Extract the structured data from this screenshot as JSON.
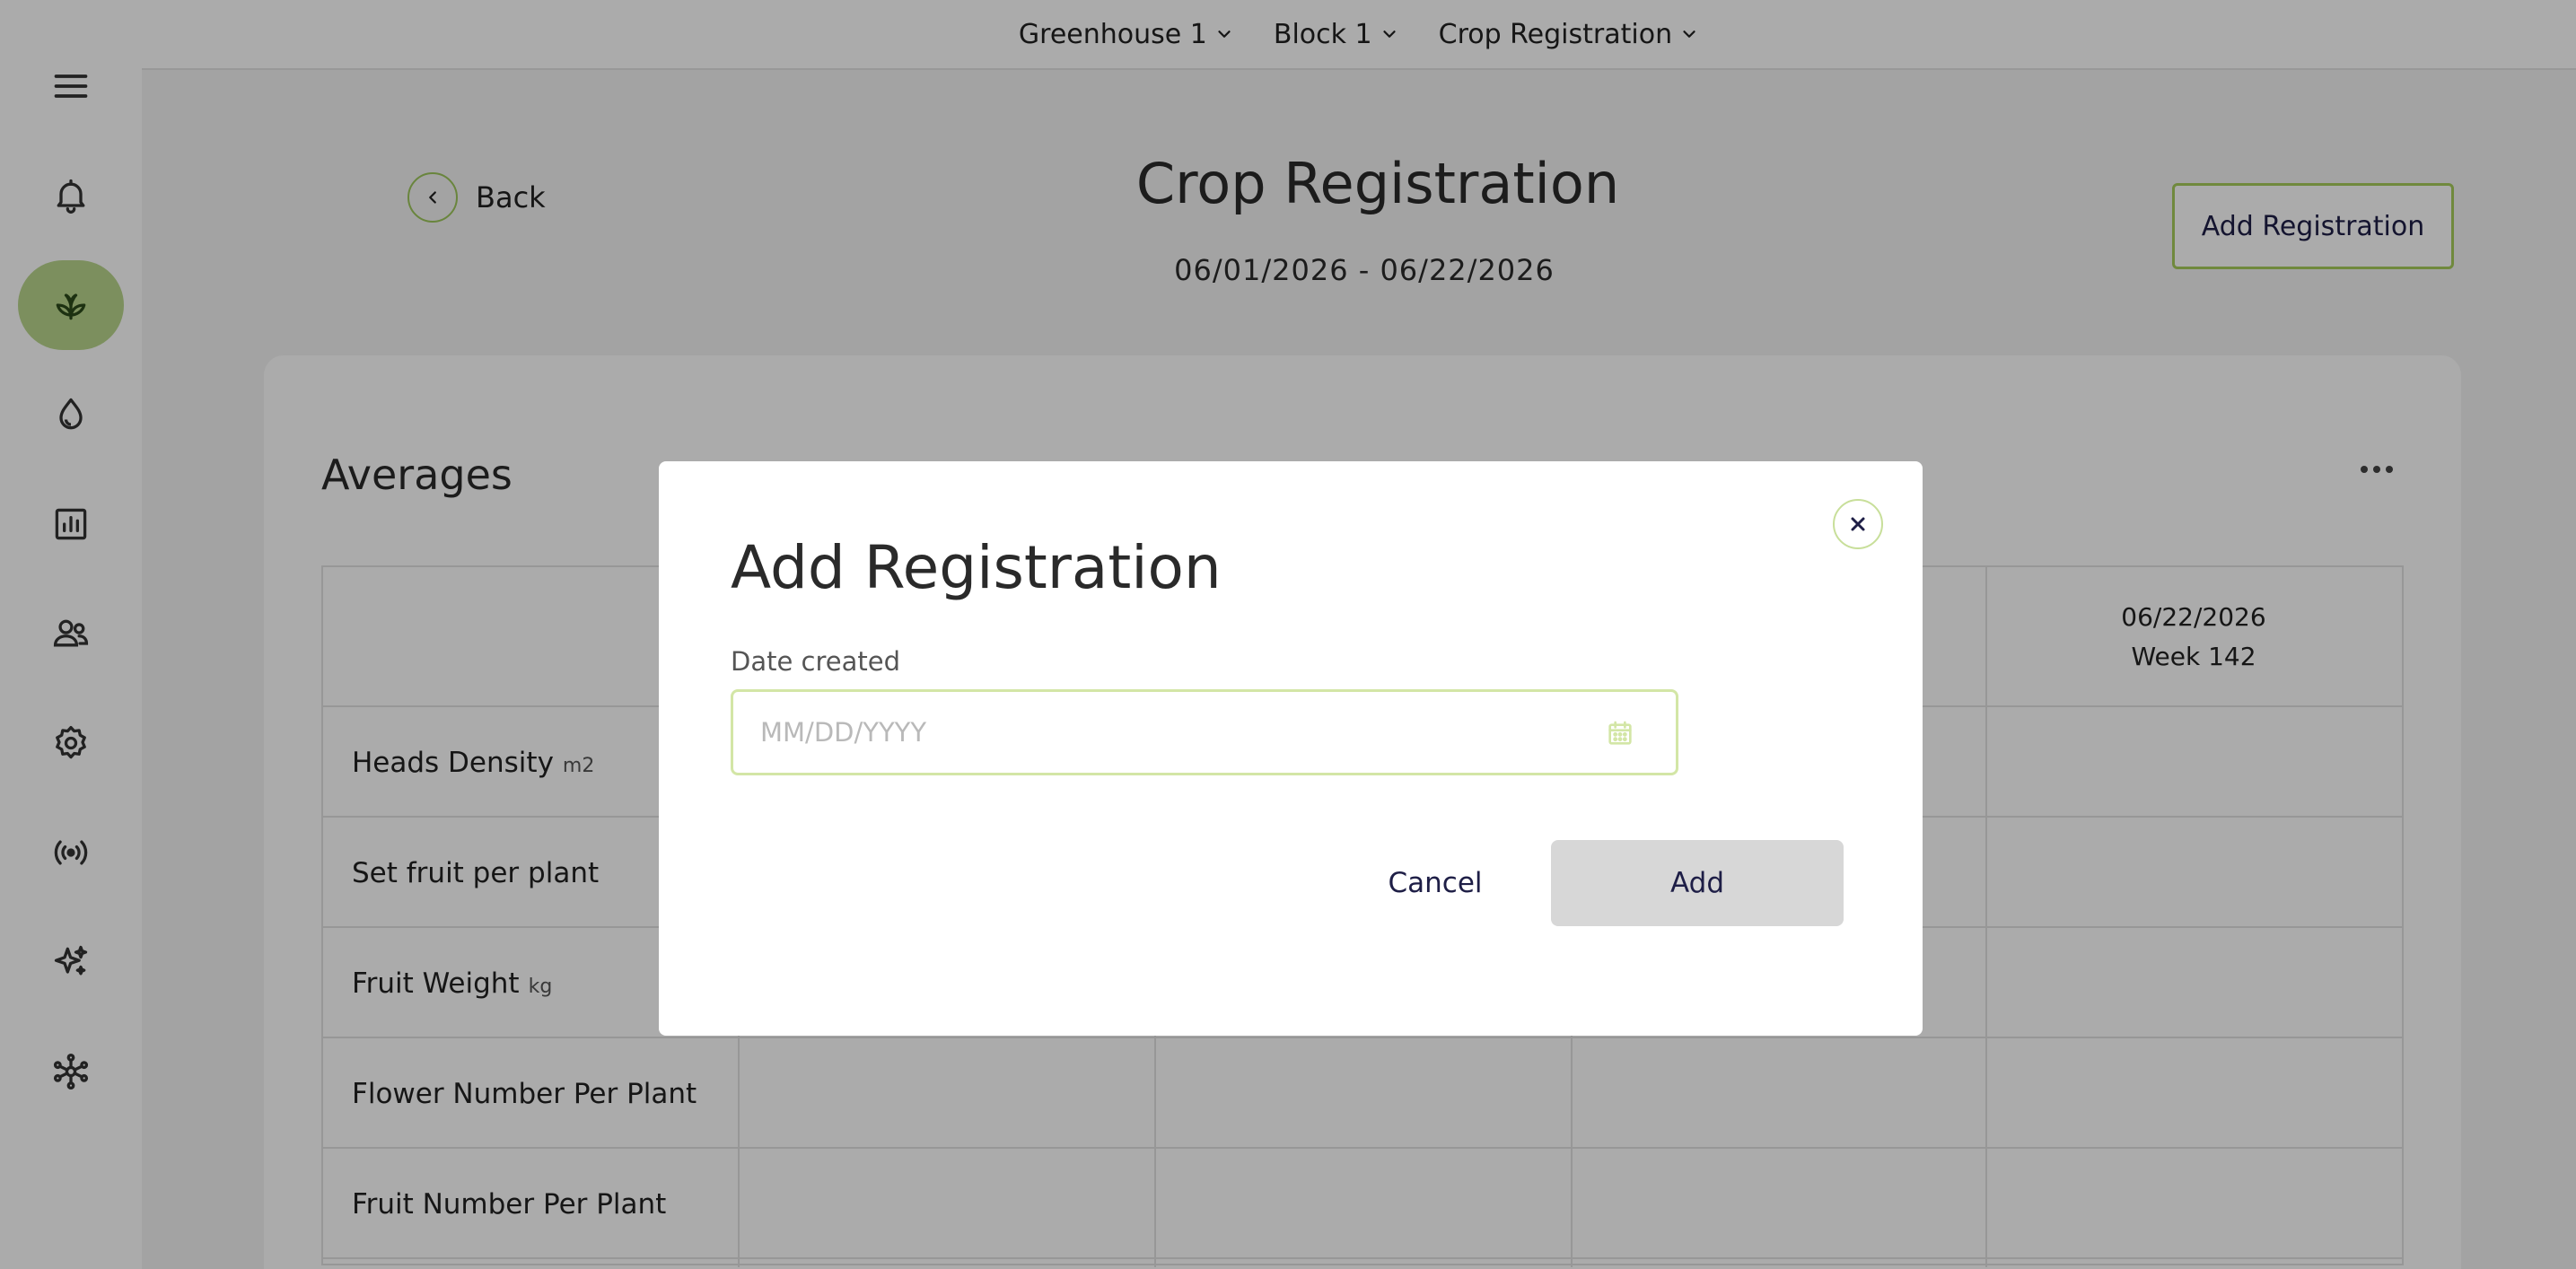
{
  "topbar": {
    "crumbs": [
      {
        "label": "Greenhouse 1"
      },
      {
        "label": "Block 1"
      },
      {
        "label": "Crop Registration"
      }
    ]
  },
  "sidebar": {
    "items": [
      {
        "icon": "menu-icon"
      },
      {
        "icon": "bell-icon"
      },
      {
        "icon": "plant-icon",
        "active": true
      },
      {
        "icon": "water-drop-icon"
      },
      {
        "icon": "bar-chart-icon"
      },
      {
        "icon": "users-icon"
      },
      {
        "icon": "gear-icon"
      },
      {
        "icon": "broadcast-icon"
      },
      {
        "icon": "sparkles-icon"
      },
      {
        "icon": "network-icon"
      }
    ]
  },
  "page": {
    "back_label": "Back",
    "title": "Crop Registration",
    "date_range": "06/01/2026 - 06/22/2026",
    "add_registration_label": "Add Registration"
  },
  "averages": {
    "title": "Averages",
    "column_header": {
      "date": "06/22/2026",
      "week": "Week 142"
    },
    "rows": [
      {
        "label": "Heads Density",
        "unit": "m2"
      },
      {
        "label": "Set fruit per plant",
        "unit": ""
      },
      {
        "label": "Fruit Weight",
        "unit": "kg"
      },
      {
        "label": "Flower Number Per Plant",
        "unit": ""
      },
      {
        "label": "Fruit Number Per Plant",
        "unit": ""
      }
    ]
  },
  "modal": {
    "title": "Add Registration",
    "field_label": "Date created",
    "date_value": "",
    "date_placeholder": "MM/DD/YYYY",
    "cancel_label": "Cancel",
    "add_label": "Add"
  },
  "colors": {
    "accent_green": "#a8cc5c",
    "active_nav": "#b9d68c",
    "button_text": "#1e1e46",
    "disabled_button": "#d7d7d7"
  }
}
